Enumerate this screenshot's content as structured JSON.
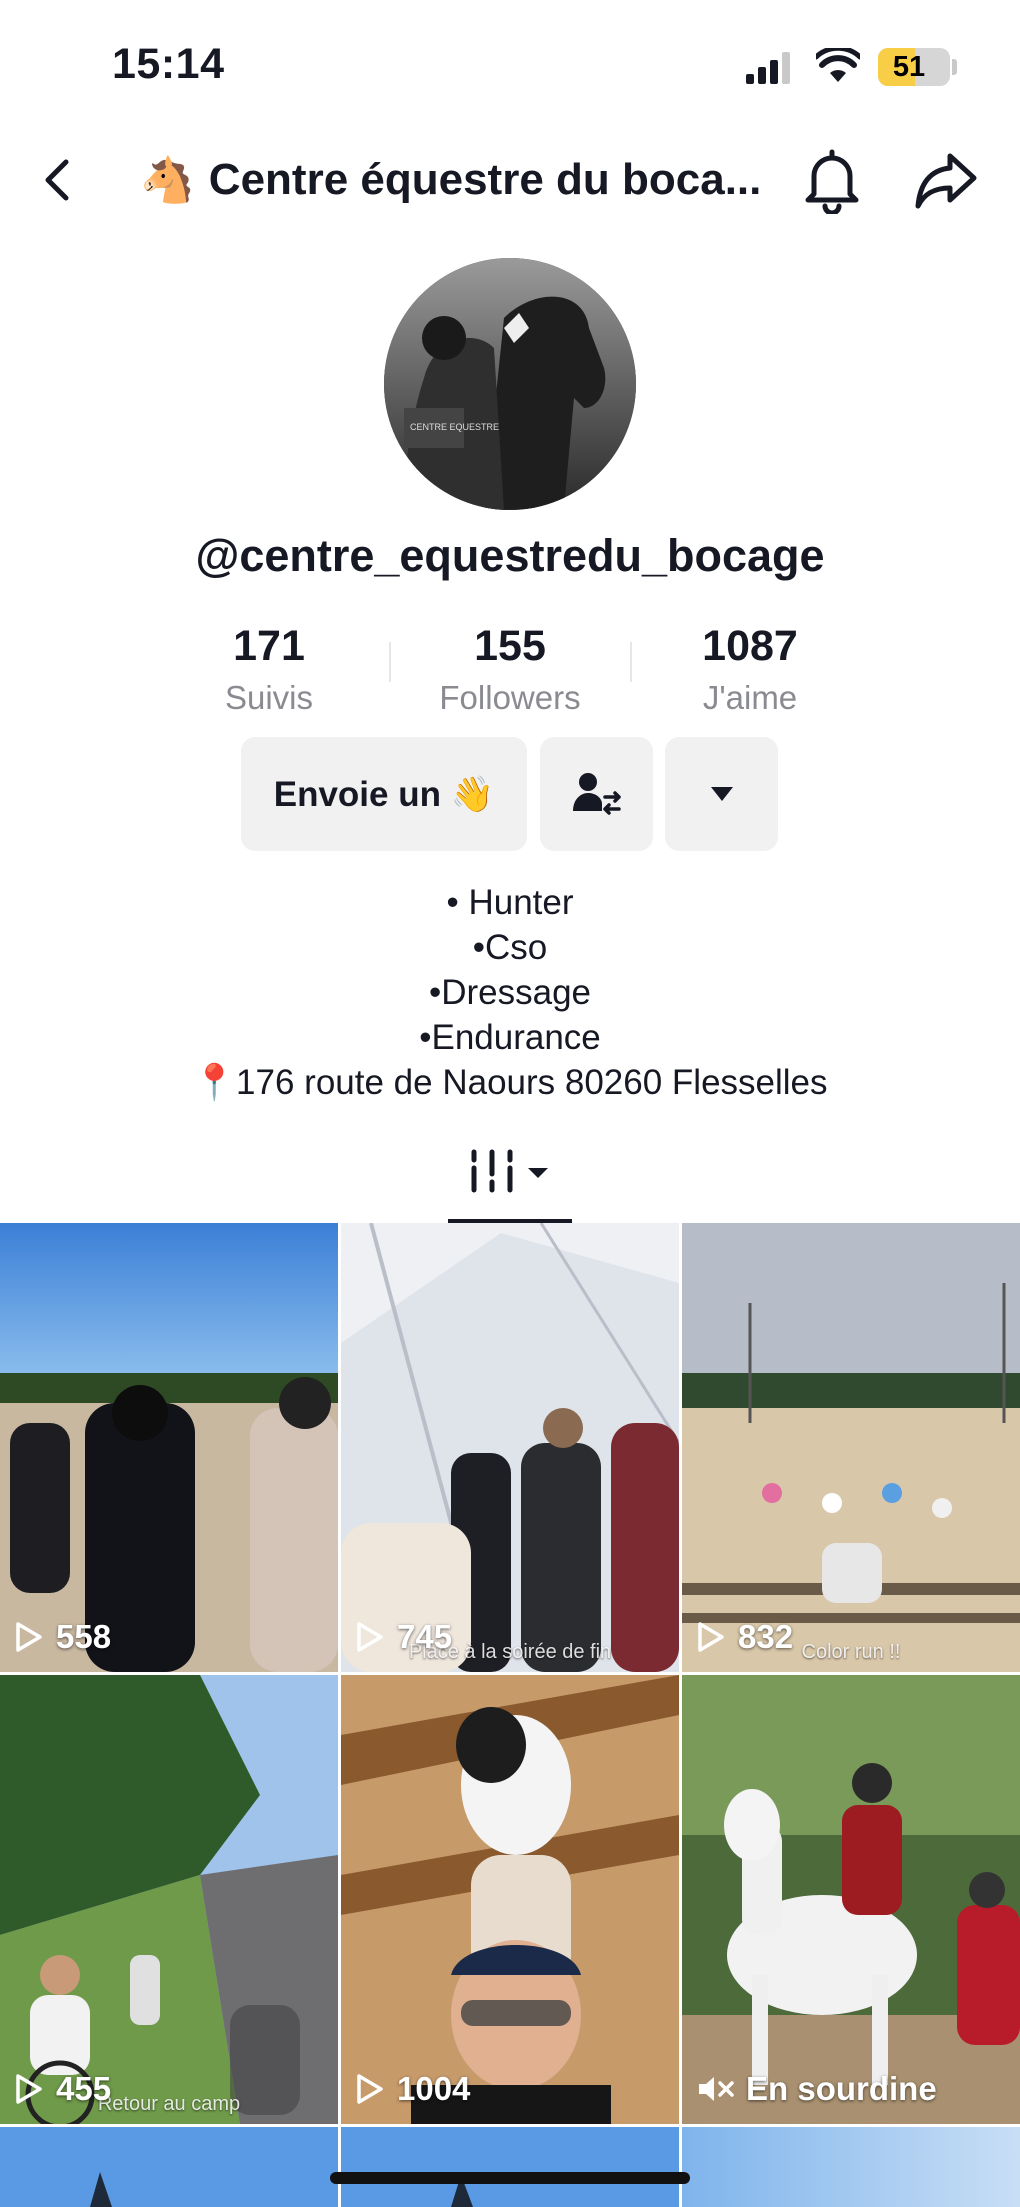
{
  "status_bar": {
    "time": "15:14",
    "battery": "51",
    "battery_level": 0.51
  },
  "header": {
    "emoji": "🐴",
    "title": "Centre équestre du boca..."
  },
  "profile": {
    "username": "@centre_equestredu_bocage",
    "stats": [
      {
        "value": "171",
        "label": "Suivis"
      },
      {
        "value": "155",
        "label": "Followers"
      },
      {
        "value": "1087",
        "label": "J'aime"
      }
    ],
    "message_button": "Envoie un 👋",
    "bio": [
      "• Hunter",
      "•Cso",
      "•Dressage",
      "•Endurance",
      "📍176 route de Naours 80260 Flesselles"
    ]
  },
  "videos": [
    {
      "views": "558",
      "caption": ""
    },
    {
      "views": "745",
      "caption": "Place à la soirée de fin"
    },
    {
      "views": "832",
      "caption": "Color run !!"
    },
    {
      "views": "455",
      "caption": "Retour au camp"
    },
    {
      "views": "1004",
      "caption": ""
    },
    {
      "views": "",
      "caption": "",
      "muted_label": "En sourdine"
    }
  ],
  "colors": {
    "text": "#161823",
    "muted": "#8a8b91",
    "button_bg": "#f1f1f2",
    "battery": "#f7ce46"
  }
}
